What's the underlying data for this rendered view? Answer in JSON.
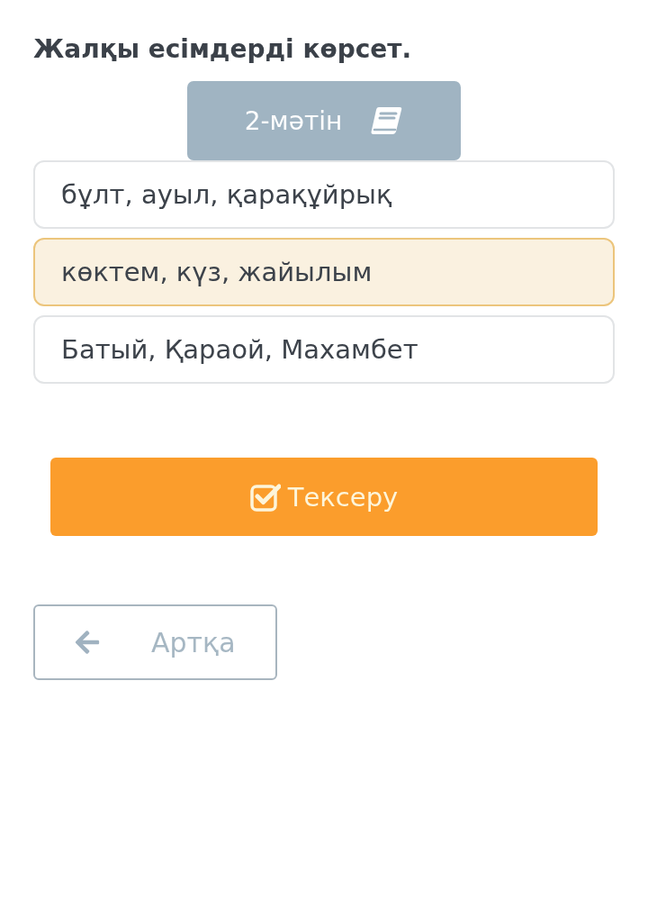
{
  "title": "Жалқы есімдерді көрсет.",
  "text_button": {
    "label": "2-мәтін"
  },
  "options": [
    {
      "label": "бұлт, ауыл, қарақұйрық",
      "selected": false
    },
    {
      "label": "көктем, күз, жайылым",
      "selected": true
    },
    {
      "label": "Батый, Қараой, Махамбет",
      "selected": false
    }
  ],
  "check_button": {
    "label": "Тексеру"
  },
  "back_button": {
    "label": "Артқа"
  }
}
